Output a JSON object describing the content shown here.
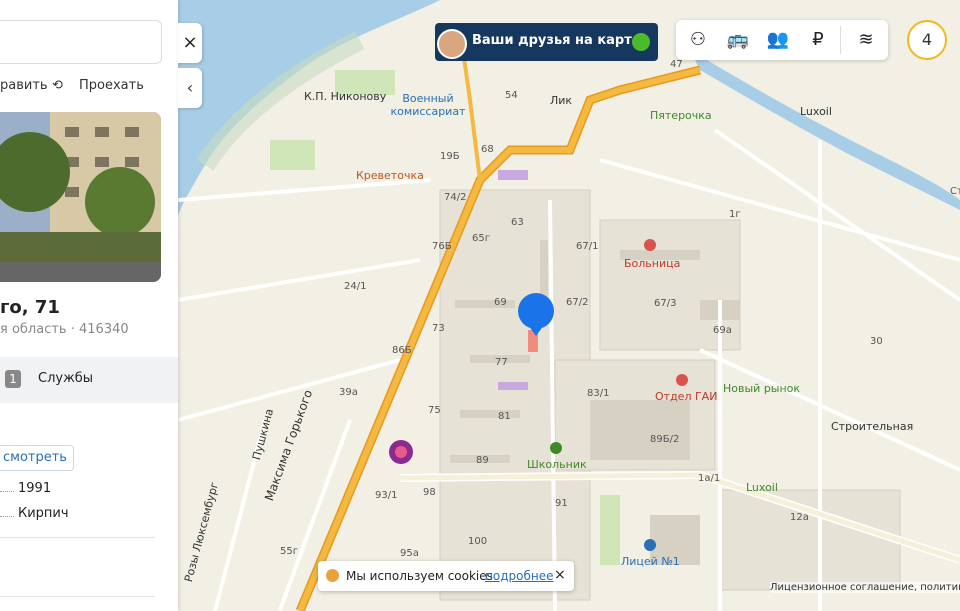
{
  "panel": {
    "action_route": "равить",
    "action_drive": "Проехать",
    "address": "го, 71",
    "region": "я область",
    "postcode": "416340",
    "services_count": "1",
    "services_label": "Службы",
    "show_button": "смотреть",
    "year": "1991",
    "material": "Кирпич"
  },
  "controls": {
    "close": "×",
    "collapse": "‹",
    "banner_text": "Ваши друзья на карте!",
    "zoom_level": "4"
  },
  "map": {
    "pois": {
      "nikonov": "К.П. Никонову",
      "voenkomat": "Военный\nкомиссариат",
      "lik": "Лик",
      "pyaterochka": "Пятерочка",
      "luxoil1": "Luxoil",
      "krevetochka": "Креветочка",
      "bolnitsa": "Больница",
      "novy_rynok": "Новый рынок",
      "otdel_gai": "Отдел ГАИ",
      "shkolnik": "Школьник",
      "luxoil2": "Luxoil",
      "litsey": "Лицей №1"
    },
    "streets": {
      "gorkogo": "Максима Горького",
      "pushkina": "Пушкина",
      "luxemburg": "Розы Люксембург",
      "stroitelnaya": "Строительная"
    },
    "house_numbers": [
      "54",
      "47",
      "68",
      "19Б",
      "74/2",
      "63",
      "65г",
      "67/1",
      "76Б",
      "24/1",
      "69",
      "67/2",
      "67/3",
      "73",
      "69а",
      "86Б",
      "77",
      "83/1",
      "39а",
      "75",
      "81",
      "89Б/2",
      "89",
      "1а/1",
      "93/1",
      "98",
      "91",
      "12а",
      "100",
      "95а",
      "55г",
      "1г",
      "30",
      "Ст"
    ]
  },
  "cookie": {
    "text": "Мы используем cookies",
    "more": "подробнее",
    "close": "×"
  },
  "license": "Лицензионное соглашение, политика к",
  "colors": {
    "water": "#a8cde6",
    "land": "#f2efe4",
    "major_road": "#f5b840",
    "banner": "#16385f",
    "pin": "#1a73e8"
  }
}
